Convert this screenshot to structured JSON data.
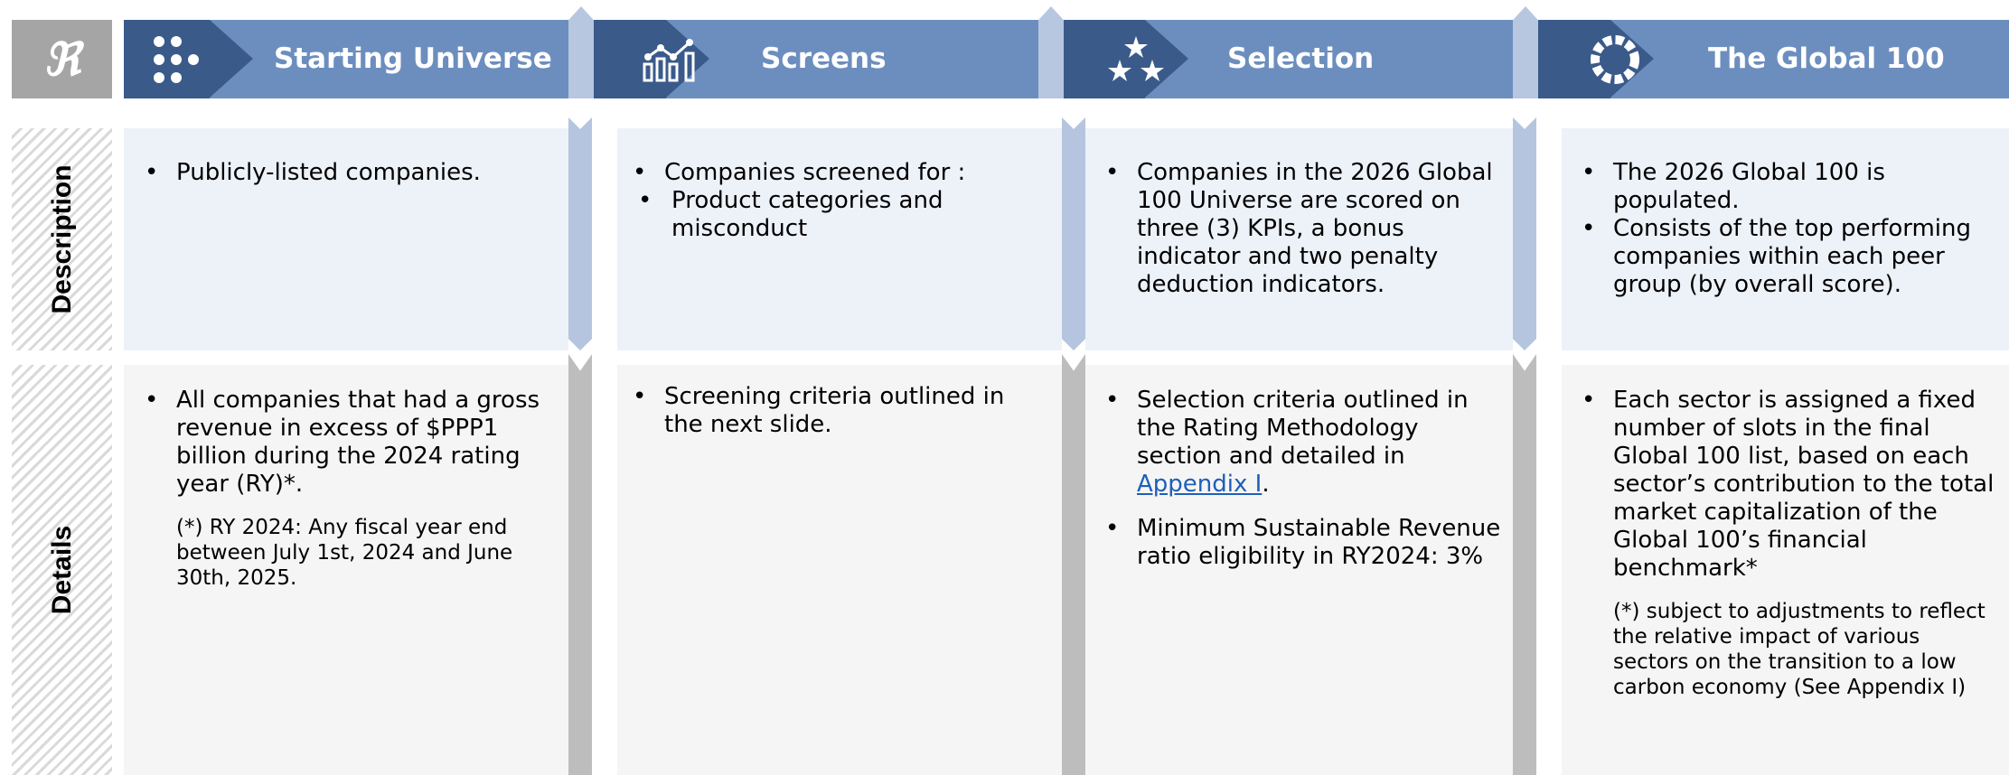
{
  "logo": {
    "glyph": "ℜ"
  },
  "headers": [
    {
      "title": "Starting Universe",
      "icon": "grid-dots-icon"
    },
    {
      "title": "Screens",
      "icon": "chart-icon"
    },
    {
      "title": "Selection",
      "icon": "stars-icon"
    },
    {
      "title": "The Global 100",
      "icon": "ring-icon"
    }
  ],
  "rows": {
    "description_label": "Description",
    "details_label": "Details"
  },
  "description": {
    "col1": {
      "b1": "Publicly-listed companies."
    },
    "col2": {
      "b1": "Companies screened for :",
      "sub1": "Product categories and misconduct"
    },
    "col3": {
      "b1": "Companies in the 2026 Global 100 Universe are scored on three (3) KPIs, a bonus indicator and two penalty deduction indicators."
    },
    "col4": {
      "b1": "The 2026 Global 100 is populated.",
      "b2": "Consists of the top performing companies within each peer group (by overall score)."
    }
  },
  "details": {
    "col1": {
      "b1": "All companies that had a gross revenue in excess of $PPP1 billion during the 2024 rating year (RY)*.",
      "note": "(*) RY 2024: Any fiscal year end between July 1st, 2024 and June 30th, 2025."
    },
    "col2": {
      "b1": "Screening criteria outlined in the next slide."
    },
    "col3": {
      "b1_pre": "Selection criteria outlined in the Rating Methodology section and detailed in ",
      "b1_link": "Appendix I",
      "b1_post": ".",
      "b2": "Minimum Sustainable Revenue ratio eligibility in RY2024: 3%"
    },
    "col4": {
      "b1": "Each sector is assigned a fixed number of slots in the final Global 100 list, based on each sector’s contribution to the total market capitalization of the Global 100’s financial benchmark*",
      "note": "(*) subject to adjustments to reflect the relative impact of various sectors on the transition to a low carbon economy (See Appendix I)"
    }
  },
  "colors": {
    "header_light": "#6c8ebf",
    "header_dark": "#3a5a8a",
    "desc_bg": "#edf1f8",
    "details_bg": "#f5f5f5"
  }
}
